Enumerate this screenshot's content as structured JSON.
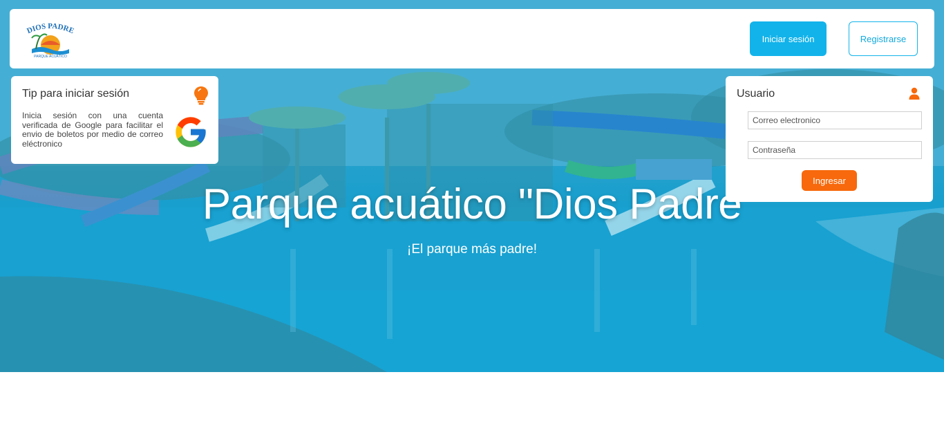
{
  "brand": {
    "logo_text": "DIOS PADRE",
    "logo_subtext": "PARQUE ACUÁTICO"
  },
  "navbar": {
    "login_label": "Iniciar sesión",
    "register_label": "Registrarse"
  },
  "hero": {
    "title": "Parque acuático \"Dios Padre",
    "subtitle": "¡El parque más padre!"
  },
  "tip": {
    "title": "Tip para iniciar sesión",
    "text": "Inicia sesión con una cuenta verificada de Google para facilitar el envio de boletos por medio de correo eléctronico",
    "icon": "lightbulb-icon",
    "logo": "google-icon"
  },
  "login": {
    "title": "Usuario",
    "icon": "user-icon",
    "email_placeholder": "Correo electronico",
    "password_placeholder": "Contraseña",
    "submit_label": "Ingresar"
  },
  "colors": {
    "primary": "#12b3ea",
    "accent": "#f7690c"
  }
}
